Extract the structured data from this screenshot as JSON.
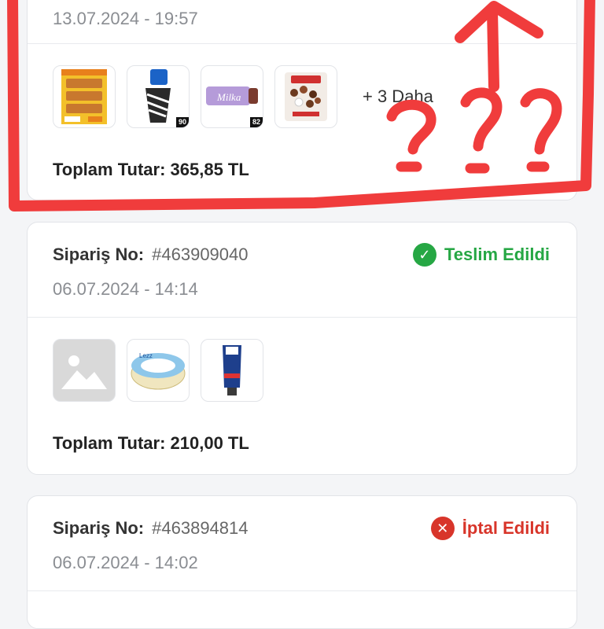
{
  "orders": [
    {
      "date": "13.07.2024 - 19:57",
      "more_label": "+ 3 Daha",
      "total": "Toplam Tutar: 365,85 TL",
      "products": [
        "wafer-pack-icon",
        "ice-cream-cone-icon",
        "milka-bar-icon",
        "chocolate-bag-icon"
      ],
      "product_tags": [
        "",
        "",
        "90",
        "82"
      ]
    },
    {
      "order_label": "Sipariş No:",
      "order_number": "#463909040",
      "status": "Teslim Edildi",
      "date": "06.07.2024 - 14:14",
      "total": "Toplam Tutar: 210,00 TL",
      "products": [
        "image-placeholder-icon",
        "cream-cheese-tub-icon",
        "toothpaste-tube-icon"
      ]
    },
    {
      "order_label": "Sipariş No:",
      "order_number": "#463894814",
      "status": "İptal Edildi",
      "date": "06.07.2024 - 14:02"
    }
  ],
  "colors": {
    "delivered": "#26a744",
    "cancelled": "#d8352a",
    "annotation": "#f03c3c"
  }
}
